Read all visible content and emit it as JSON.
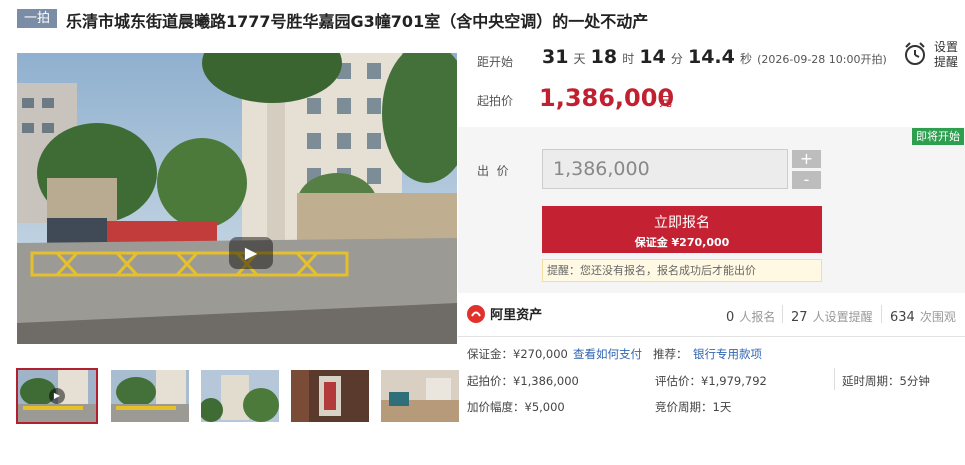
{
  "header": {
    "badge": "一拍",
    "title": "乐清市城东街道晨曦路1777号胜华嘉园G3幢701室（含中央空调）的一处不动产"
  },
  "countdown": {
    "label": "距开始",
    "days": "31",
    "days_unit": "天",
    "hours": "18",
    "hours_unit": "时",
    "minutes": "14",
    "minutes_unit": "分",
    "seconds": "14.4",
    "seconds_unit": "秒",
    "start_time": "(2026-09-28 10:00开拍)"
  },
  "remind": {
    "icon": "alarm-clock-icon",
    "line1": "设置",
    "line2": "提醒"
  },
  "start_price": {
    "label": "起拍价",
    "value": "1,386,000",
    "unit": "元"
  },
  "bid": {
    "status_badge": "即将开始",
    "label": "出  价",
    "input_value": "1,386,000",
    "plus": "+",
    "minus": "-",
    "signup_label": "立即报名",
    "deposit_label": "保证金 ¥270,000",
    "tip": "提醒：您还没有报名，报名成功后才能出价"
  },
  "platform": {
    "logo_text": "阿里资产",
    "logo_icon": "alibaba-logo-icon"
  },
  "stats": [
    {
      "num": "0",
      "text": "人报名"
    },
    {
      "num": "27",
      "text": "人设置提醒"
    },
    {
      "num": "634",
      "text": "次围观"
    }
  ],
  "info": {
    "deposit": "保证金：¥270,000",
    "how_to_pay": "查看如何支付",
    "recommend_label": "推荐：",
    "recommend_link": "银行专用款项",
    "start_price": "起拍价：¥1,386,000",
    "appraisal": "评估价：¥1,979,792",
    "delay": "延时周期：5分钟",
    "increment": "加价幅度：¥5,000",
    "bid_cycle": "竞价周期：1天"
  },
  "colors": {
    "accent": "#c42132",
    "badge": "#7b8da6",
    "green": "#2e9e4f",
    "link": "#2f66b4"
  }
}
